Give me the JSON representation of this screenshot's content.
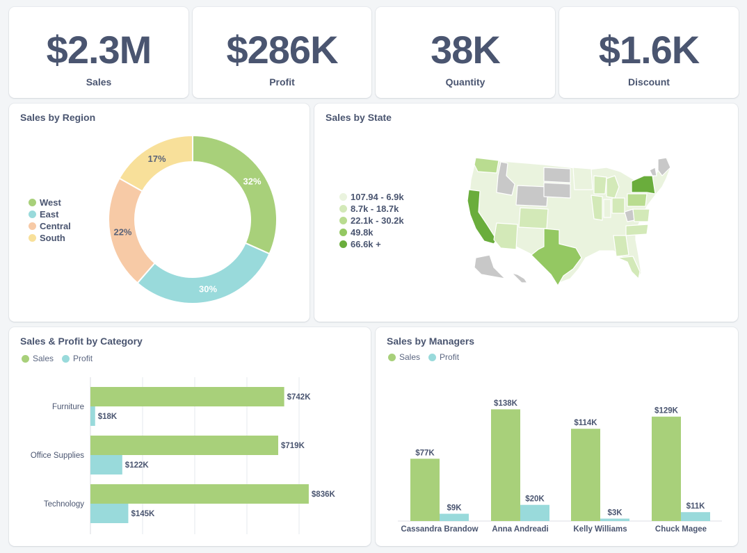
{
  "kpis": [
    {
      "value": "$2.3M",
      "label": "Sales"
    },
    {
      "value": "$286K",
      "label": "Profit"
    },
    {
      "value": "38K",
      "label": "Quantity"
    },
    {
      "value": "$1.6K",
      "label": "Discount"
    }
  ],
  "colors": {
    "green": "#a8d07a",
    "teal": "#99dadb",
    "orange": "#f7caa6",
    "yellow": "#f8e09a",
    "map_gray": "#c8c8c8"
  },
  "state_legend": [
    {
      "label": "107.94 - 6.9k",
      "color": "#eaf3de"
    },
    {
      "label": "8.7k - 18.7k",
      "color": "#d3e9b8"
    },
    {
      "label": "22.1k - 30.2k",
      "color": "#b9dc90"
    },
    {
      "label": "49.8k",
      "color": "#94c862"
    },
    {
      "label": "66.6k +",
      "color": "#6aad3c"
    }
  ],
  "chart_data": [
    {
      "type": "pie",
      "title": "Sales by Region",
      "categories": [
        "West",
        "East",
        "Central",
        "South"
      ],
      "values": [
        32,
        30,
        22,
        17
      ],
      "labels": [
        "32%",
        "30%",
        "22%",
        "17%"
      ],
      "colors": [
        "#a8d07a",
        "#99dadb",
        "#f7caa6",
        "#f8e09a"
      ],
      "legend": "left"
    },
    {
      "type": "bar",
      "title": "Sales & Profit by Category",
      "orientation": "horizontal",
      "categories": [
        "Furniture",
        "Office Supplies",
        "Technology"
      ],
      "series": [
        {
          "name": "Sales",
          "values": [
            742,
            719,
            836
          ],
          "labels": [
            "$742K",
            "$719K",
            "$836K"
          ],
          "color": "#a8d07a"
        },
        {
          "name": "Profit",
          "values": [
            18,
            122,
            145
          ],
          "labels": [
            "$18K",
            "$122K",
            "$145K"
          ],
          "color": "#99dadb"
        }
      ],
      "xlim": [
        0,
        1000
      ],
      "grid": true,
      "legend": "top-left"
    },
    {
      "type": "bar",
      "title": "Sales by Managers",
      "categories": [
        "Cassandra Brandow",
        "Anna Andreadi",
        "Kelly Williams",
        "Chuck Magee"
      ],
      "series": [
        {
          "name": "Sales",
          "values": [
            77,
            138,
            114,
            129
          ],
          "labels": [
            "$77K",
            "$138K",
            "$114K",
            "$129K"
          ],
          "color": "#a8d07a"
        },
        {
          "name": "Profit",
          "values": [
            9,
            20,
            3,
            11
          ],
          "labels": [
            "$9K",
            "$20K",
            "$3K",
            "$11K"
          ],
          "color": "#99dadb"
        }
      ],
      "ylim": [
        0,
        160
      ],
      "grid": false,
      "legend": "top-left"
    }
  ]
}
